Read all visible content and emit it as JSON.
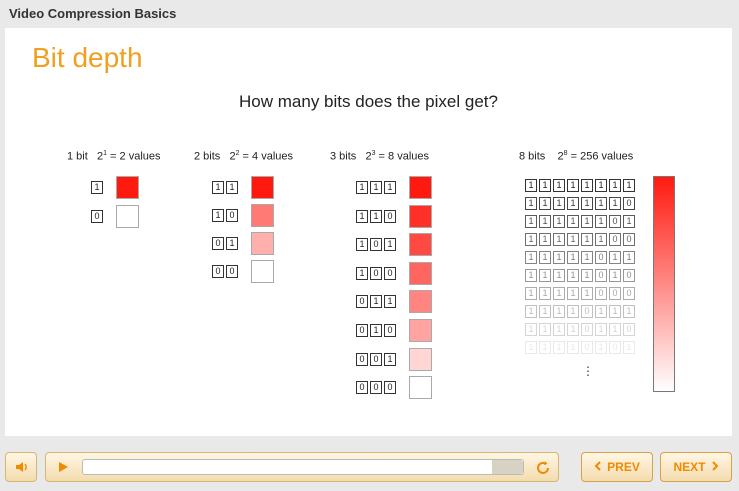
{
  "course": {
    "title": "Video Compression Basics"
  },
  "slide": {
    "title": "Bit depth",
    "question": "How many bits does the pixel get?"
  },
  "columns": [
    {
      "bits_label": "1 bit",
      "formula": "2",
      "exp": "1",
      "values_label": " = 2 values",
      "rows": [
        {
          "bits": [
            "1"
          ],
          "color": "#ff1a10"
        },
        {
          "bits": [
            "0"
          ],
          "color": "#ffffff"
        }
      ]
    },
    {
      "bits_label": "2 bits",
      "formula": "2",
      "exp": "2",
      "values_label": " = 4 values",
      "rows": [
        {
          "bits": [
            "1",
            "1"
          ],
          "color": "#ff1a10"
        },
        {
          "bits": [
            "1",
            "0"
          ],
          "color": "#ff7a74"
        },
        {
          "bits": [
            "0",
            "1"
          ],
          "color": "#ffb0ad"
        },
        {
          "bits": [
            "0",
            "0"
          ],
          "color": "#ffffff"
        }
      ]
    },
    {
      "bits_label": "3 bits",
      "formula": "2",
      "exp": "3",
      "values_label": " = 8 values",
      "rows": [
        {
          "bits": [
            "1",
            "1",
            "1"
          ],
          "color": "#ff1a10"
        },
        {
          "bits": [
            "1",
            "1",
            "0"
          ],
          "color": "#ff3028"
        },
        {
          "bits": [
            "1",
            "0",
            "1"
          ],
          "color": "#ff4a44"
        },
        {
          "bits": [
            "1",
            "0",
            "0"
          ],
          "color": "#ff6660"
        },
        {
          "bits": [
            "0",
            "1",
            "1"
          ],
          "color": "#ff8580"
        },
        {
          "bits": [
            "0",
            "1",
            "0"
          ],
          "color": "#ffa4a0"
        },
        {
          "bits": [
            "0",
            "0",
            "1"
          ],
          "color": "#ffd6d4"
        },
        {
          "bits": [
            "0",
            "0",
            "0"
          ],
          "color": "#ffffff"
        }
      ]
    },
    {
      "bits_label": "8 bits",
      "formula": "2",
      "exp": "8",
      "values_label": " = 256 values",
      "rows": [
        {
          "bits": [
            "1",
            "1",
            "1",
            "1",
            "1",
            "1",
            "1",
            "1"
          ],
          "opacity": 1.0
        },
        {
          "bits": [
            "1",
            "1",
            "1",
            "1",
            "1",
            "1",
            "1",
            "0"
          ],
          "opacity": 0.9
        },
        {
          "bits": [
            "1",
            "1",
            "1",
            "1",
            "1",
            "1",
            "0",
            "1"
          ],
          "opacity": 0.8
        },
        {
          "bits": [
            "1",
            "1",
            "1",
            "1",
            "1",
            "1",
            "0",
            "0"
          ],
          "opacity": 0.7
        },
        {
          "bits": [
            "1",
            "1",
            "1",
            "1",
            "1",
            "0",
            "1",
            "1"
          ],
          "opacity": 0.6
        },
        {
          "bits": [
            "1",
            "1",
            "1",
            "1",
            "1",
            "0",
            "1",
            "0"
          ],
          "opacity": 0.5
        },
        {
          "bits": [
            "1",
            "1",
            "1",
            "1",
            "1",
            "0",
            "0",
            "0"
          ],
          "opacity": 0.4
        },
        {
          "bits": [
            "1",
            "1",
            "1",
            "1",
            "0",
            "1",
            "1",
            "1"
          ],
          "opacity": 0.3
        },
        {
          "bits": [
            "1",
            "1",
            "1",
            "1",
            "0",
            "1",
            "1",
            "0"
          ],
          "opacity": 0.2
        },
        {
          "bits": [
            "1",
            "1",
            "1",
            "1",
            "0",
            "1",
            "0",
            "1"
          ],
          "opacity": 0.1
        }
      ],
      "ellipsis": "⋮"
    }
  ],
  "controls": {
    "prev_label": "PREV",
    "next_label": "NEXT",
    "accent": "#f08a00",
    "icons": [
      "speaker-icon",
      "play-icon",
      "replay-icon",
      "chevron-left-icon",
      "chevron-right-icon"
    ]
  }
}
